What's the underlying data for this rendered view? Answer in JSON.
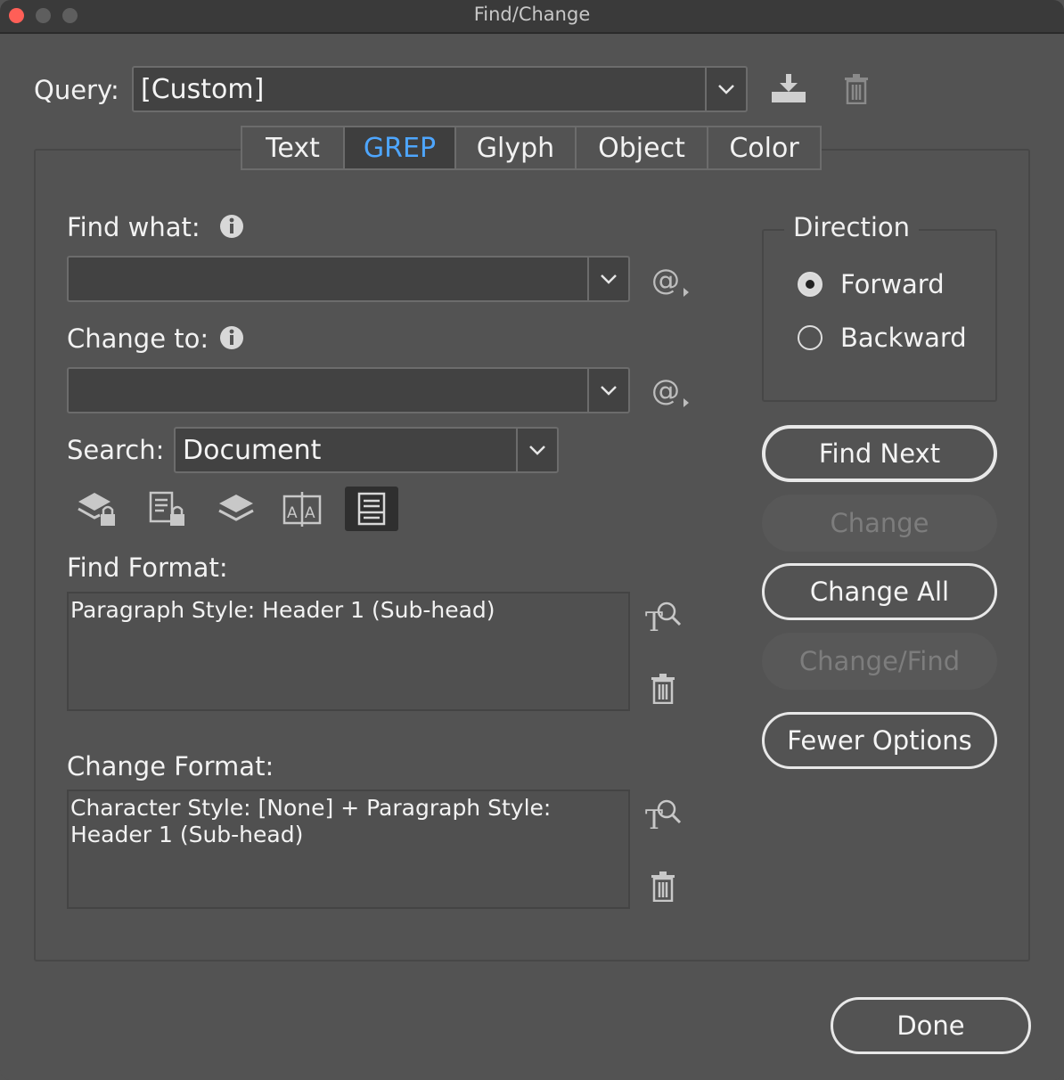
{
  "window": {
    "title": "Find/Change"
  },
  "query": {
    "label": "Query:",
    "value": "[Custom]"
  },
  "tabs": [
    {
      "label": "Text",
      "active": false
    },
    {
      "label": "GREP",
      "active": true
    },
    {
      "label": "Glyph",
      "active": false
    },
    {
      "label": "Object",
      "active": false
    },
    {
      "label": "Color",
      "active": false
    }
  ],
  "find_what": {
    "label": "Find what:",
    "value": ""
  },
  "change_to": {
    "label": "Change to:",
    "value": ""
  },
  "search": {
    "label": "Search:",
    "value": "Document"
  },
  "find_format": {
    "label": "Find Format:",
    "value": "Paragraph Style: Header 1 (Sub-head)"
  },
  "change_format": {
    "label": "Change Format:",
    "line1": "Character Style: [None] + Paragraph Style:",
    "line2": "Header 1 (Sub-head)"
  },
  "direction": {
    "legend": "Direction",
    "forward": "Forward",
    "backward": "Backward",
    "selected": "Forward"
  },
  "buttons": {
    "find_next": "Find Next",
    "change": "Change",
    "change_all": "Change All",
    "change_find": "Change/Find",
    "fewer_options": "Fewer Options",
    "done": "Done"
  },
  "colors": {
    "accent": "#4ea6ff",
    "background": "#535353",
    "field": "#424242"
  }
}
